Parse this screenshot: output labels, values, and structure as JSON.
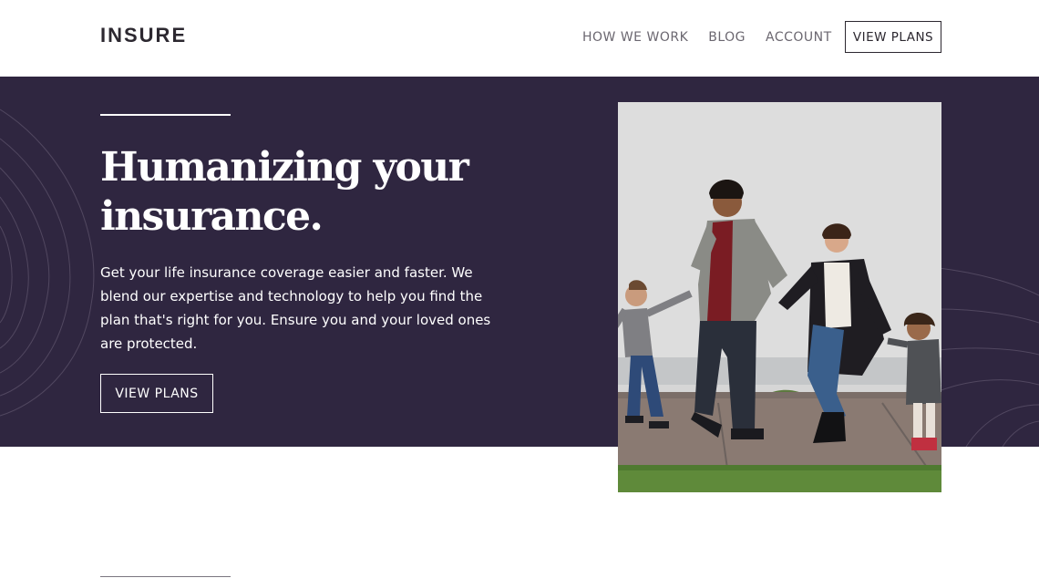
{
  "header": {
    "logo": "INSURE",
    "nav": [
      {
        "label": "HOW WE WORK"
      },
      {
        "label": "BLOG"
      },
      {
        "label": "ACCOUNT"
      }
    ],
    "cta_label": "VIEW PLANS"
  },
  "hero": {
    "title_line1": "Humanizing your",
    "title_line2": "insurance.",
    "description": "Get your life insurance coverage easier and faster. We blend our expertise and technology to help you find the plan that's right for you. Ensure you and your loved ones are protected.",
    "button_label": "VIEW PLANS",
    "image_subject": "family-walking-photo"
  },
  "colors": {
    "brand_dark": "#2f2640",
    "text_dark": "#2c2830",
    "nav_gray": "#6b6770",
    "white": "#ffffff"
  },
  "icons": {
    "decoration_left": "curve-pattern-left",
    "decoration_right": "curve-pattern-right"
  }
}
